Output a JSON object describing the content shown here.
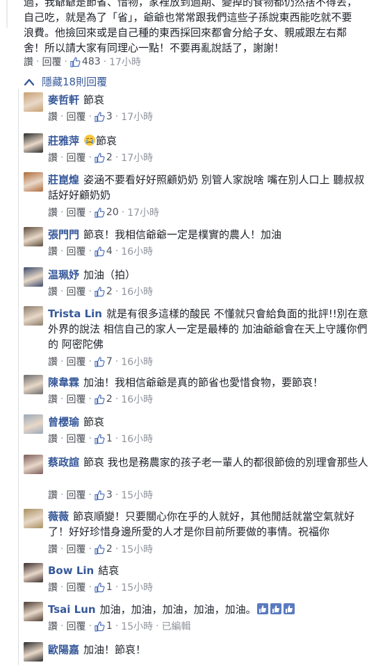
{
  "top_comment": {
    "lines": [
      "過，我爺爺是節省、惜物，家裡放到過期、變掉的食物都仍然捨不得丟，",
      "自己吃，就是為了「省」，爺爺也常常跟我們這些子孫說東西能吃就不要",
      "浪費。他撿回來或是自己種的東西採回來都會分給子女、親戚跟左右鄰",
      "舍！所以請大家有同理心一點！不要再亂說話了，謝謝！"
    ],
    "like_label": "讚",
    "reply_label": "回覆",
    "likes": "483",
    "time": "17小時"
  },
  "hidden_replies_label": "隱藏18則回覆",
  "replies": [
    {
      "name": "麥哲軒",
      "text": "節哀",
      "likes": "3",
      "time": "17小時",
      "avatar_color": "#c8a070"
    },
    {
      "name": "莊雅萍",
      "text": "節哀",
      "likes": "2",
      "time": "17小時",
      "avatar_color": "#2a2a2a",
      "emoji": "crying-face"
    },
    {
      "name": "莊崑煌",
      "text": "姿涵不要看好好照顧奶奶 別管人家說啥 嘴在別人口上 聽叔叔話好好顧奶奶",
      "likes": "20",
      "time": "17小時",
      "avatar_color": "#b06a3a"
    },
    {
      "name": "張門門",
      "text": "節哀！我相信爺爺一定是樸實的農人！加油",
      "likes": "4",
      "time": "16小時",
      "avatar_color": "#5a4a3a"
    },
    {
      "name": "温珮妤",
      "text": "加油（拍）",
      "likes": "2",
      "time": "16小時",
      "avatar_color": "#3a4a6a"
    },
    {
      "name": "Trista Lin",
      "text": "就是有很多這樣的酸民 不懂就只會給負面的批評!!別在意外界的說法 相信自己的家人一定是最棒的 加油爺爺會在天上守護你們的 阿密陀佛",
      "likes": "7",
      "time": "16小時",
      "avatar_color": "#8a7a6a"
    },
    {
      "name": "陳韋霖",
      "text": "加油！我相信爺爺是真的節省也愛惜食物，要節哀！",
      "likes": "2",
      "time": "16小時",
      "avatar_color": "#6a6a6a"
    },
    {
      "name": "曾櫻瑜",
      "text": "節哀",
      "likes": "1",
      "time": "16小時",
      "avatar_color": "#9aa8b8"
    },
    {
      "name": "蔡政諠",
      "text": "節哀 我也是務農家的孩子老一輩人的都很節儉的別理會那些人",
      "likes": "3",
      "time": "15小時",
      "avatar_color": "#7a5a5a"
    },
    {
      "name": "薇薇",
      "text": "節哀順變！只要關心你在乎的人就好，其他閒話就當空氣就好了！好好珍惜身邊所愛的人才是你目前所要做的事情。祝福你",
      "likes": "2",
      "time": "15小時",
      "avatar_color": "#a89060"
    },
    {
      "name": "Bow Lin",
      "text": "結哀",
      "likes": "1",
      "time": "15小時",
      "avatar_color": "#3a2a2a"
    },
    {
      "name": "Tsai Lun",
      "text": "加油，加油，加油，加油，加油。",
      "likes": "1",
      "time": "15小時",
      "avatar_color": "#4a3a30",
      "emoji": "thumbs-up-row",
      "edited": "已編輯"
    },
    {
      "name": "歐陽嘉",
      "text": "加油！節哀！",
      "likes": "",
      "time": "",
      "avatar_color": "#2a2a2a"
    }
  ],
  "labels": {
    "like": "讚",
    "reply": "回覆"
  },
  "colors": {
    "name_link": "#365899",
    "meta": "#90949c",
    "like_blue": "#4267b2"
  }
}
